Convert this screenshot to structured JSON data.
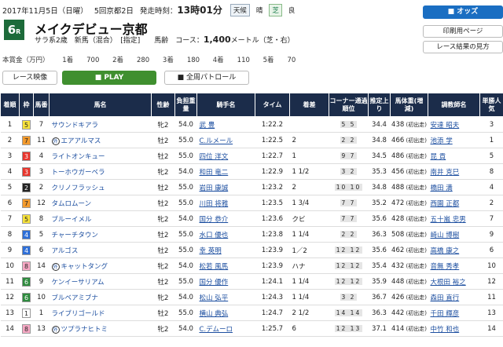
{
  "header": {
    "date": "2017年11月5日（日曜）",
    "meeting": "5回京都2日",
    "start_label": "発走時刻：",
    "start_time": "13時01分",
    "weather_label": "天候",
    "weather": "晴",
    "track": "芝",
    "going": "良"
  },
  "race": {
    "number": "6",
    "number_suffix": "R",
    "name": "メイクデビュー京都",
    "conditions": "サラ系2歳　新馬（混合）　[指定]　　馬齢",
    "course_label": "コース：",
    "distance": "1,400",
    "course_unit": "メートル（芝・右）"
  },
  "prize": {
    "label": "本賞金（万円）",
    "items": [
      "1着　　700",
      "2着　　280",
      "3着　　180",
      "4着　　110",
      "5着　　70"
    ]
  },
  "buttons": {
    "odds": "■ オッズ",
    "print": "印刷用ページ",
    "guide": "レース結果の見方",
    "video": "レース映像",
    "play": "■ PLAY",
    "patrol": "■ 全周パトロール"
  },
  "colors": {
    "header_bg": "#1b2c4a",
    "play": "#3f8f2f",
    "odds": "#1a6ec2"
  },
  "columns": [
    "着順",
    "枠",
    "馬番",
    "馬名",
    "性齢",
    "負担重量",
    "騎手名",
    "タイム",
    "着差",
    "コーナー通過順位",
    "推定上り",
    "馬体重(増減)",
    "調教師名",
    "単勝人気"
  ],
  "rows": [
    {
      "pos": "1",
      "frame": "5",
      "fbg": "#f7e23a",
      "fc": "#222",
      "num": "7",
      "name": "サウンドキアラ",
      "sex": "牝2",
      "wt": "54.0",
      "jockey": "武 豊",
      "time": "1:22.2",
      "margin": "",
      "corner": "5 5",
      "last": "34.4",
      "body": "438",
      "chg": "(初出走)",
      "trainer": "安達 昭夫",
      "pop": "3"
    },
    {
      "pos": "2",
      "frame": "7",
      "fbg": "#f39a2c",
      "fc": "#222",
      "num": "11",
      "mark": "外",
      "name": "エアアルマス",
      "sex": "牡2",
      "wt": "55.0",
      "jockey": "C.ルメール",
      "time": "1:22.5",
      "margin": "2",
      "corner": "2 2",
      "last": "34.8",
      "body": "466",
      "chg": "(初出走)",
      "trainer": "池添 学",
      "pop": "1"
    },
    {
      "pos": "3",
      "frame": "3",
      "fbg": "#e8352c",
      "fc": "#fff",
      "num": "4",
      "name": "ライトオンキュー",
      "sex": "牡2",
      "wt": "55.0",
      "jockey": "四位 洋文",
      "time": "1:22.7",
      "margin": "1",
      "corner": "9 7",
      "last": "34.5",
      "body": "486",
      "chg": "(初出走)",
      "trainer": "昆 貢",
      "pop": "5"
    },
    {
      "pos": "4",
      "frame": "3",
      "fbg": "#e8352c",
      "fc": "#fff",
      "num": "3",
      "name": "トーホウガーベラ",
      "sex": "牝2",
      "wt": "54.0",
      "jockey": "和田 竜二",
      "time": "1:22.9",
      "margin": "1 1/2",
      "corner": "3 2",
      "last": "35.3",
      "body": "456",
      "chg": "(初出走)",
      "trainer": "南井 克巳",
      "pop": "8"
    },
    {
      "pos": "5",
      "frame": "2",
      "fbg": "#222",
      "fc": "#fff",
      "num": "2",
      "name": "クリノフラッシュ",
      "sex": "牡2",
      "wt": "55.0",
      "jockey": "岩田 康誠",
      "time": "1:23.2",
      "margin": "2",
      "corner": "10 10",
      "last": "34.8",
      "body": "488",
      "chg": "(初出走)",
      "trainer": "橋田 満",
      "pop": "4"
    },
    {
      "pos": "6",
      "frame": "7",
      "fbg": "#f39a2c",
      "fc": "#222",
      "num": "12",
      "name": "タムロムーン",
      "sex": "牡2",
      "wt": "55.0",
      "jockey": "川田 将雅",
      "time": "1:23.5",
      "margin": "1 3/4",
      "corner": "7 7",
      "last": "35.2",
      "body": "472",
      "chg": "(初出走)",
      "trainer": "西園 正都",
      "pop": "2"
    },
    {
      "pos": "7",
      "frame": "5",
      "fbg": "#f7e23a",
      "fc": "#222",
      "num": "8",
      "name": "ブルーイメル",
      "sex": "牝2",
      "wt": "54.0",
      "jockey": "国分 恭介",
      "time": "1:23.6",
      "margin": "クビ",
      "corner": "7 7",
      "last": "35.6",
      "body": "428",
      "chg": "(初出走)",
      "trainer": "五十嵐 忠男",
      "pop": "7"
    },
    {
      "pos": "8",
      "frame": "4",
      "fbg": "#2e6fd8",
      "fc": "#fff",
      "num": "5",
      "name": "チャーチタウン",
      "sex": "牡2",
      "wt": "55.0",
      "jockey": "水口 優也",
      "time": "1:23.8",
      "margin": "1 1/4",
      "corner": "2 2",
      "last": "36.3",
      "body": "508",
      "chg": "(初出走)",
      "trainer": "崎山 博樹",
      "pop": "9"
    },
    {
      "pos": "9",
      "frame": "4",
      "fbg": "#2e6fd8",
      "fc": "#fff",
      "num": "6",
      "name": "アルゴス",
      "sex": "牡2",
      "wt": "55.0",
      "jockey": "幸 英明",
      "time": "1:23.9",
      "margin": "1／2",
      "corner": "12 12",
      "last": "35.6",
      "body": "462",
      "chg": "(初出走)",
      "trainer": "高橋 康之",
      "pop": "6"
    },
    {
      "pos": "10",
      "frame": "8",
      "fbg": "#f7a8c4",
      "fc": "#222",
      "num": "14",
      "mark": "外",
      "name": "キャットタング",
      "sex": "牝2",
      "wt": "54.0",
      "jockey": "松若 風馬",
      "time": "1:23.9",
      "margin": "ハナ",
      "corner": "12 12",
      "last": "35.4",
      "body": "432",
      "chg": "(初出走)",
      "trainer": "音無 秀孝",
      "pop": "10"
    },
    {
      "pos": "11",
      "frame": "6",
      "fbg": "#2e8b3e",
      "fc": "#fff",
      "num": "9",
      "name": "ケンイーサリアム",
      "sex": "牡2",
      "wt": "55.0",
      "jockey": "国分 優作",
      "time": "1:24.1",
      "margin": "1 1/4",
      "corner": "12 12",
      "last": "35.9",
      "body": "448",
      "chg": "(初出走)",
      "trainer": "大根田 裕之",
      "pop": "12"
    },
    {
      "pos": "12",
      "frame": "6",
      "fbg": "#2e8b3e",
      "fc": "#fff",
      "num": "10",
      "name": "ブルベアミブナ",
      "sex": "牝2",
      "wt": "54.0",
      "jockey": "松山 弘平",
      "time": "1:24.3",
      "margin": "1 1/4",
      "corner": "3 2",
      "last": "36.7",
      "body": "426",
      "chg": "(初出走)",
      "trainer": "森田 直行",
      "pop": "11"
    },
    {
      "pos": "13",
      "frame": "1",
      "fbg": "#ffffff",
      "fc": "#222",
      "num": "1",
      "name": "ライブリゴールド",
      "sex": "牡2",
      "wt": "55.0",
      "jockey": "横山 典弘",
      "time": "1:24.7",
      "margin": "2 1/2",
      "corner": "14 14",
      "last": "36.3",
      "body": "442",
      "chg": "(初出走)",
      "trainer": "千田 輝彦",
      "pop": "13"
    },
    {
      "pos": "14",
      "frame": "8",
      "fbg": "#f7a8c4",
      "fc": "#222",
      "num": "13",
      "mark": "外",
      "name": "ツプラナヒトミ",
      "sex": "牝2",
      "wt": "54.0",
      "jockey": "C.デムーロ",
      "time": "1:25.7",
      "margin": "6",
      "corner": "12 13",
      "last": "37.1",
      "body": "414",
      "chg": "(初出走)",
      "trainer": "中竹 和也",
      "pop": "14"
    }
  ]
}
